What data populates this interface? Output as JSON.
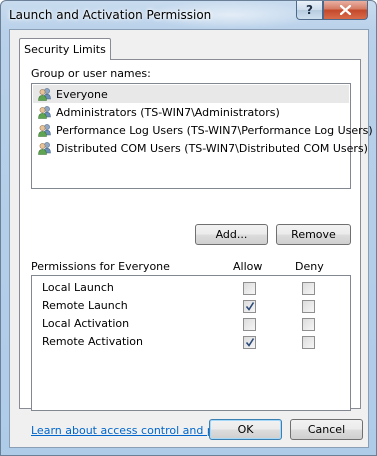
{
  "window": {
    "title": "Launch and Activation Permission",
    "help_label": "?",
    "close_label": "x"
  },
  "tab": {
    "label": "Security Limits"
  },
  "groups": {
    "label": "Group or user names:",
    "items": [
      {
        "name": "Everyone",
        "selected": true
      },
      {
        "name": "Administrators (TS-WIN7\\Administrators)",
        "selected": false
      },
      {
        "name": "Performance Log Users (TS-WIN7\\Performance Log Users)",
        "selected": false
      },
      {
        "name": "Distributed COM Users (TS-WIN7\\Distributed COM Users)",
        "selected": false
      }
    ]
  },
  "buttons": {
    "add": "Add...",
    "remove": "Remove",
    "ok": "OK",
    "cancel": "Cancel"
  },
  "permissions": {
    "label": "Permissions for Everyone",
    "allow_header": "Allow",
    "deny_header": "Deny",
    "rows": [
      {
        "name": "Local Launch",
        "allow": false,
        "deny": false
      },
      {
        "name": "Remote Launch",
        "allow": true,
        "deny": false
      },
      {
        "name": "Local Activation",
        "allow": false,
        "deny": false
      },
      {
        "name": "Remote Activation",
        "allow": true,
        "deny": false
      }
    ]
  },
  "link": {
    "text": "Learn about access control and permissions"
  },
  "icons": {
    "user": "users-group-icon",
    "check": "checkmark-icon"
  }
}
